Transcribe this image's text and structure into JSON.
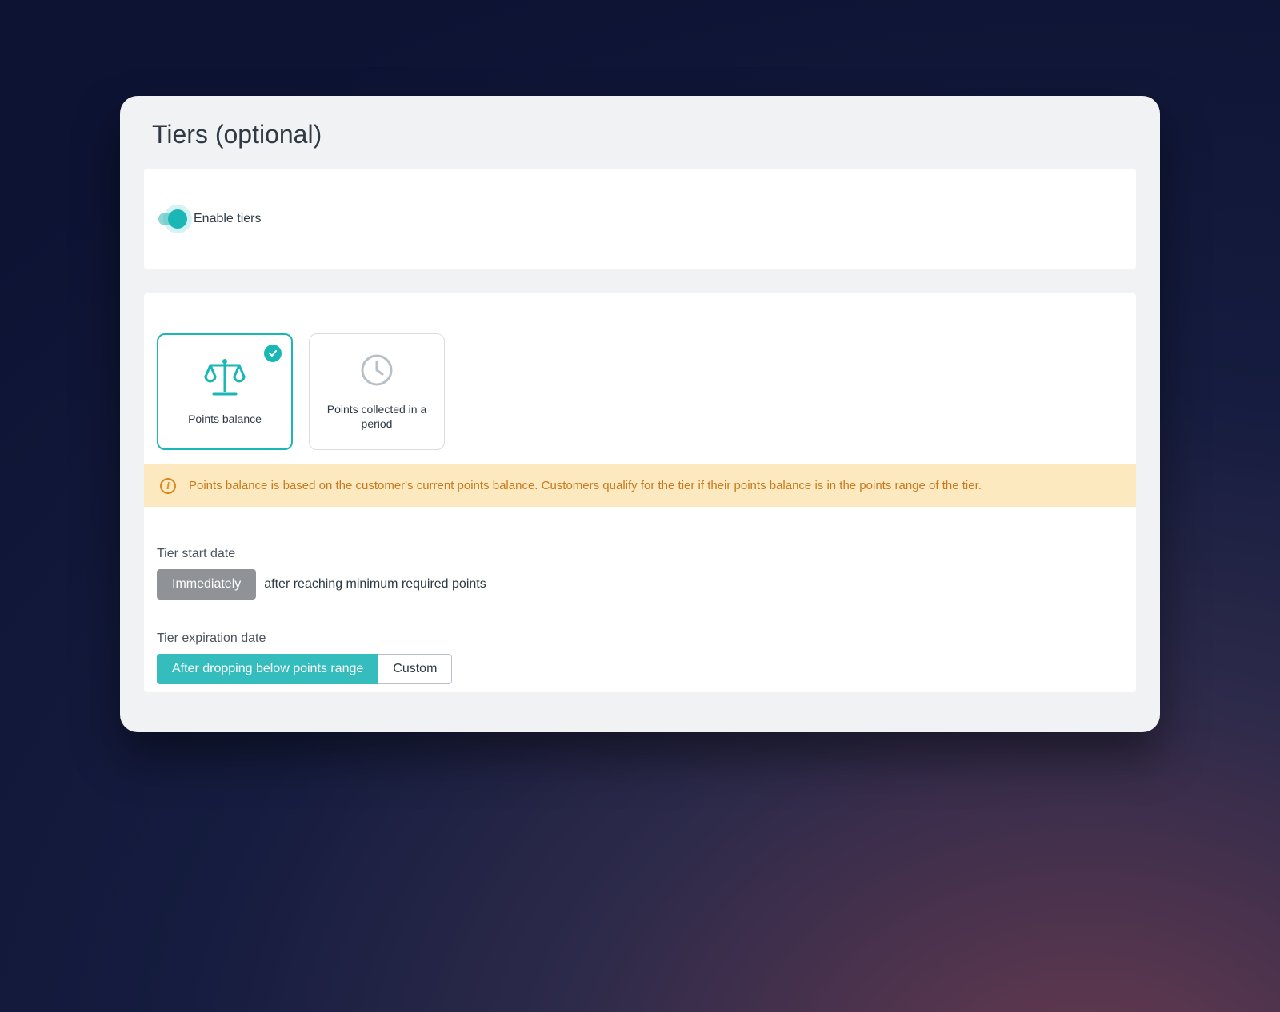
{
  "panel": {
    "title": "Tiers (optional)"
  },
  "enable": {
    "label": "Enable tiers",
    "value": true
  },
  "options": {
    "balance": {
      "label": "Points balance",
      "selected": true
    },
    "period": {
      "label": "Points collected in a period",
      "selected": false
    }
  },
  "info": {
    "text": "Points balance is based on the customer's current points balance. Customers qualify for the tier if their points balance is in the points range of the tier."
  },
  "start": {
    "label": "Tier start date",
    "button": "Immediately",
    "suffix": "after reaching minimum required points"
  },
  "expiration": {
    "label": "Tier expiration date",
    "active": "After dropping below points range",
    "custom": "Custom"
  }
}
